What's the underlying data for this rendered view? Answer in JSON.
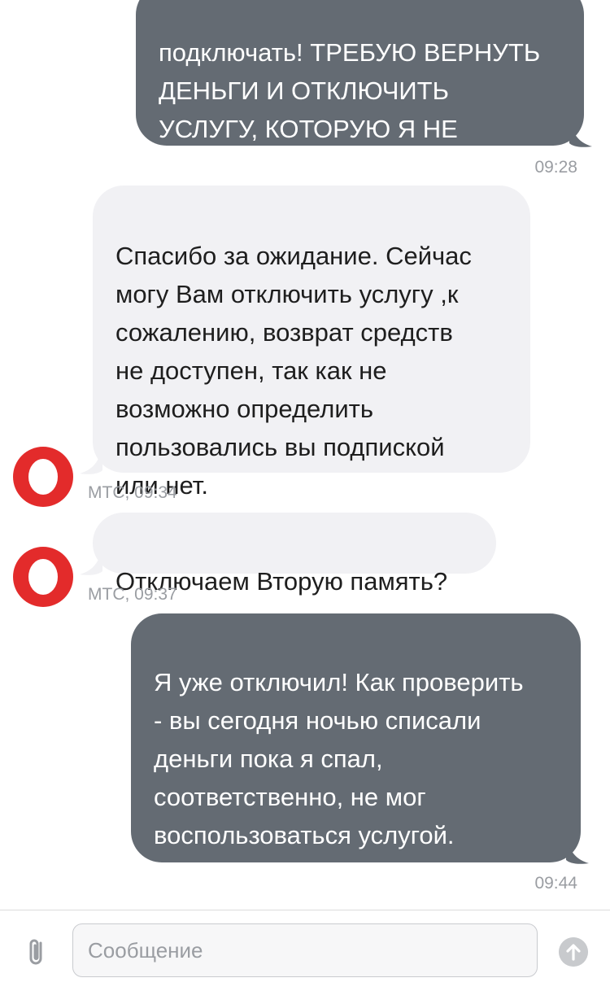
{
  "messages": [
    {
      "direction": "out",
      "text": "подключать! ТРЕБУЮ ВЕРНУТЬ\nДЕНЬГИ И ОТКЛЮЧИТЬ\nУСЛУГУ, КОТОРУЮ Я НЕ\nПОДКЛЮЧАЛ!",
      "time": "09:28"
    },
    {
      "direction": "in",
      "text": "Спасибо за ожидание. Сейчас\nмогу Вам отключить услугу ,к\nсожалению, возврат средств\nне доступен, так как не\nвозможно определить\nпользовались вы подпиской\nили нет.",
      "meta": "МТС, 09:34"
    },
    {
      "direction": "in",
      "text": "Отключаем Вторую память?",
      "meta": "МТС, 09:37"
    },
    {
      "direction": "out",
      "text": "Я уже отключил! Как проверить\n- вы сегодня ночью списали\nденьги пока я спал,\nсоответственно, не мог\nвоспользоваться услугой.\nВЕРНИТЕ ДЕНЬГИ, ВОРЫ!!!!",
      "time": "09:44"
    }
  ],
  "composer": {
    "placeholder": "Сообщение"
  },
  "icons": {
    "attach": "paperclip-icon",
    "send": "send-arrow-icon",
    "avatar": "mts-logo-icon"
  },
  "colors": {
    "outgoing": "#646b73",
    "incoming": "#f1f1f4",
    "avatar": "#e32b2b"
  }
}
